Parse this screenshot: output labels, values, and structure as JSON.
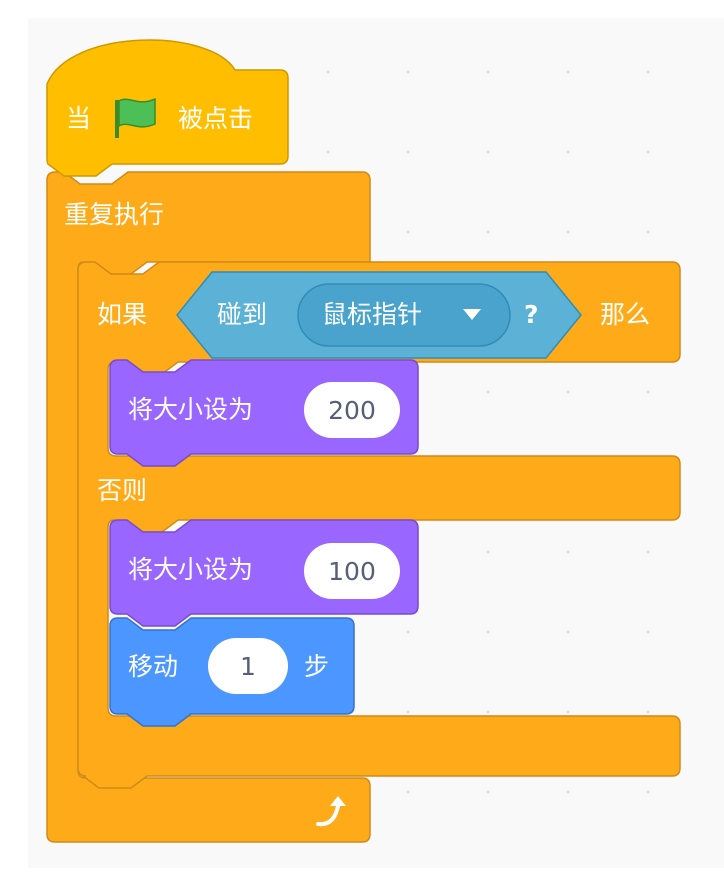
{
  "script": {
    "hat": {
      "when": "当",
      "flag_icon": "green-flag-icon",
      "clicked": "被点击"
    },
    "forever": {
      "label": "重复执行",
      "loop_icon": "loop-arrow-icon"
    },
    "if_else": {
      "if": "如果",
      "then": "那么",
      "else": "否则",
      "condition": {
        "label": "碰到",
        "menu_value": "鼠标指针",
        "question": "?"
      }
    },
    "set_size_1": {
      "label": "将大小设为",
      "value": "200"
    },
    "set_size_2": {
      "label": "将大小设为",
      "value": "100"
    },
    "move": {
      "label": "移动",
      "value": "1",
      "unit": "步"
    }
  },
  "colors": {
    "events": "#ffbf00",
    "control": "#ffab19",
    "control_border": "#cf8b17",
    "sensing": "#5cb1d6",
    "sensing_border": "#2e8eb8",
    "looks": "#9966ff",
    "looks_border": "#774dcb",
    "motion": "#4c97ff",
    "motion_border": "#3373cc"
  }
}
